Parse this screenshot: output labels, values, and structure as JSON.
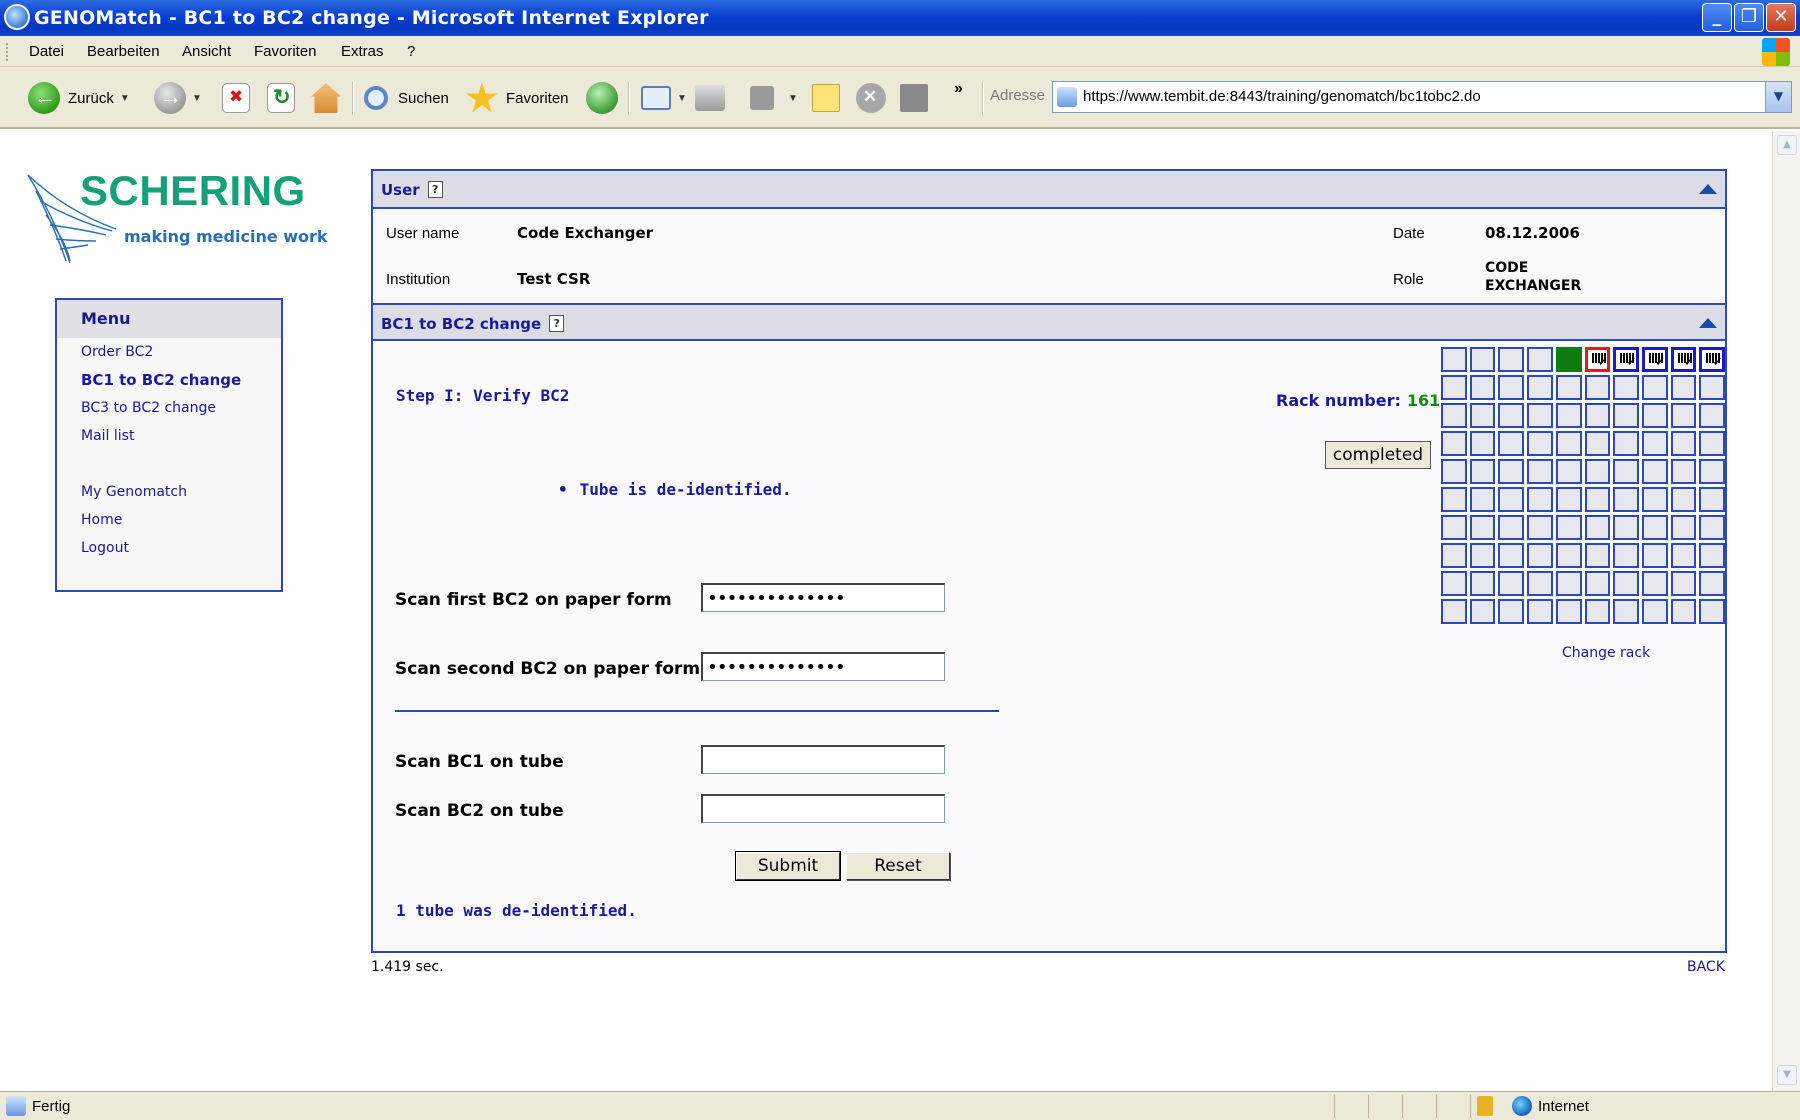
{
  "window": {
    "title": "GENOMatch - BC1 to BC2 change - Microsoft Internet Explorer"
  },
  "menubar": {
    "items": [
      "Datei",
      "Bearbeiten",
      "Ansicht",
      "Favoriten",
      "Extras",
      "?"
    ]
  },
  "toolbar": {
    "back_label": "Zurück",
    "search_label": "Suchen",
    "favorites_label": "Favoriten",
    "more": "»",
    "address_label": "Adresse",
    "url": "https://www.tembit.de:8443/training/genomatch/bc1tobc2.do",
    "icons": [
      "back-icon",
      "forward-icon",
      "stop-icon",
      "refresh-icon",
      "home-icon",
      "search-icon",
      "favorites-star-icon",
      "history-icon",
      "mail-icon",
      "print-icon",
      "edit-icon",
      "note-icon",
      "messenger-icon",
      "research-icon"
    ]
  },
  "logo": {
    "brand": "SCHERING",
    "tagline": "making medicine work"
  },
  "sidebar": {
    "title": "Menu",
    "items": [
      {
        "label": "Order BC2",
        "active": false
      },
      {
        "label": "BC1 to BC2 change",
        "active": true
      },
      {
        "label": "BC3 to BC2 change",
        "active": false
      },
      {
        "label": "Mail list",
        "active": false
      },
      {
        "label": "My Genomatch",
        "active": false
      },
      {
        "label": "Home",
        "active": false
      },
      {
        "label": "Logout",
        "active": false
      }
    ]
  },
  "user_panel": {
    "title": "User",
    "user_name_label": "User name",
    "user_name": "Code Exchanger",
    "institution_label": "Institution",
    "institution": "Test CSR",
    "date_label": "Date",
    "date": "08.12.2006",
    "role_label": "Role",
    "role_line1": "CODE",
    "role_line2": "EXCHANGER"
  },
  "change_panel": {
    "title": "BC1 to BC2 change",
    "step_title": "Step I: Verify BC2",
    "bullet_message": "Tube is de-identified.",
    "rack_label": "Rack number:",
    "rack_number": "161",
    "status_button": "completed",
    "change_rack_link": "Change rack",
    "fields": {
      "first_bc2_label": "Scan first BC2 on paper form",
      "first_bc2_value": "••••••••••••••",
      "second_bc2_label": "Scan second BC2 on paper form",
      "second_bc2_value": "••••••••••••••",
      "bc1_tube_label": "Scan BC1 on tube",
      "bc1_tube_value": "",
      "bc2_tube_label": "Scan BC2 on tube",
      "bc2_tube_value": ""
    },
    "submit_label": "Submit",
    "reset_label": "Reset",
    "result_message": "1 tube was de-identified.",
    "rack_grid": {
      "rows": 10,
      "cols": 10,
      "first_row_states": [
        "empty",
        "empty",
        "empty",
        "empty",
        "green",
        "tube-highlight",
        "tube",
        "tube",
        "tube",
        "tube"
      ],
      "colors": {
        "cell": "#e7e7ee",
        "border": "#2d49b6",
        "green": "#0f7a0f",
        "highlight": "#e01b1b",
        "tube_border": "#1a1ac8"
      }
    }
  },
  "footer": {
    "time": "1.419 sec.",
    "back_link": "BACK"
  },
  "statusbar": {
    "text": "Fertig",
    "zone": "Internet"
  }
}
